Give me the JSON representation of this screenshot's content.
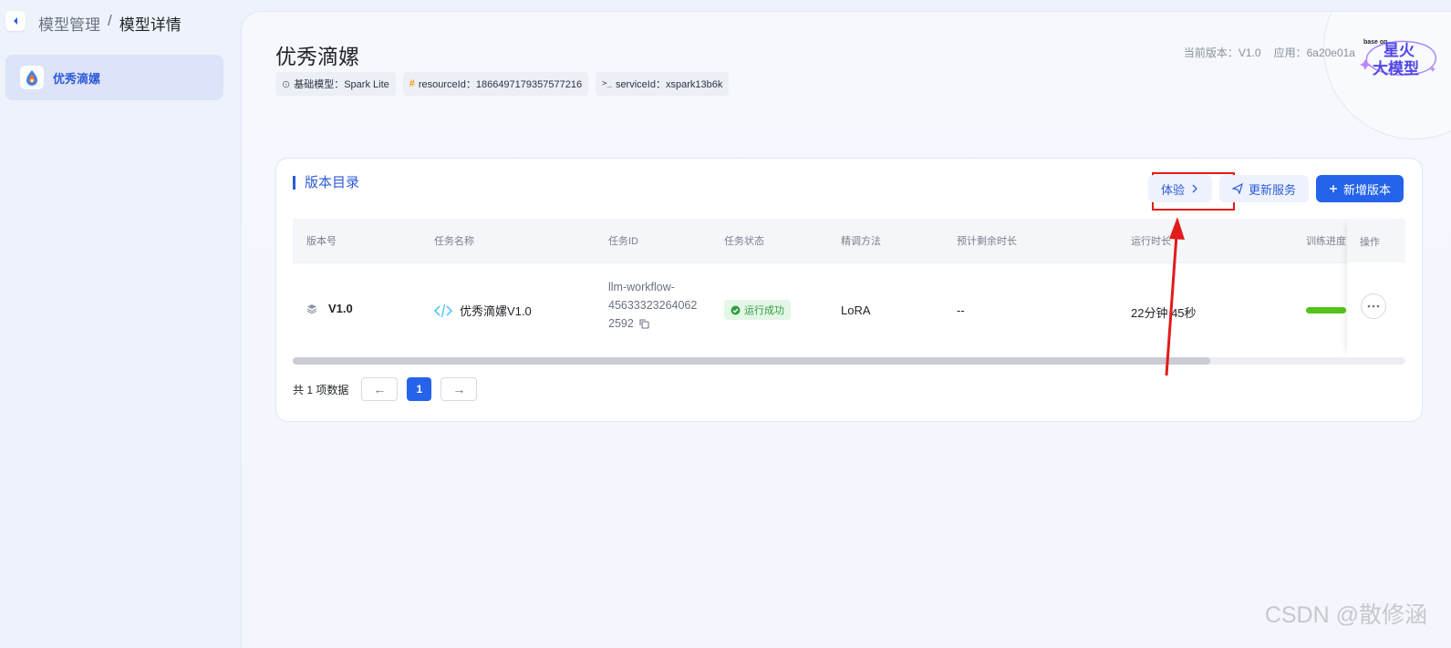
{
  "breadcrumb": {
    "parent": "模型管理",
    "separator": "/",
    "current": "模型详情"
  },
  "sidebar": {
    "items": [
      {
        "label": "优秀滴嫘",
        "active": true
      }
    ]
  },
  "model": {
    "title": "优秀滴嫘",
    "tags": [
      {
        "icon": "⊙",
        "text": "基础模型：Spark Lite"
      },
      {
        "icon": "#",
        "text": "resourceId：1866497179357577216"
      },
      {
        "icon": ">_",
        "text": "serviceId：xspark13b6k"
      }
    ],
    "current_version": "当前版本：V1.0",
    "app": "应用：6a20e01a",
    "logo": {
      "small": "base on",
      "line1": "星火",
      "line2": "大模型"
    }
  },
  "versions": {
    "title": "版本目录",
    "buttons": {
      "try": "体验",
      "update": "更新服务",
      "add": "新增版本"
    },
    "columns": [
      "版本号",
      "任务名称",
      "任务ID",
      "任务状态",
      "精调方法",
      "预计剩余时长",
      "运行时长",
      "训练进度",
      "操作"
    ],
    "rows": [
      {
        "version": "V1.0",
        "task_name": "优秀滴嫘V1.0",
        "task_id_lines": [
          "llm-workflow-",
          "45633323264062",
          "2592"
        ],
        "status": "运行成功",
        "method": "LoRA",
        "remaining": "--",
        "runtime": "22分钟 45秒",
        "progress": 1.0
      }
    ],
    "pager": {
      "total": "共 1 项数据",
      "current": "1",
      "prev": "←",
      "next": "→"
    }
  },
  "watermark": "CSDN @散修涵",
  "colors": {
    "accent": "#2563eb",
    "annotation": "#e21b1b",
    "success": "#2f9e44"
  }
}
